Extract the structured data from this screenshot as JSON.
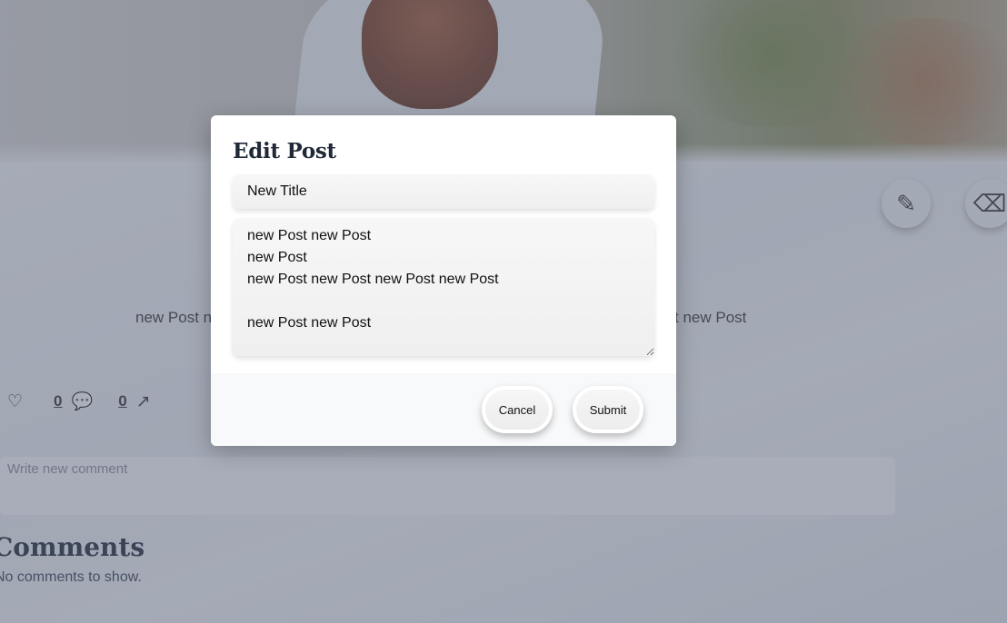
{
  "post": {
    "body_preview_left": "new Post n",
    "body_preview_right": "t new Post",
    "like_count": "0",
    "comment_count": "0"
  },
  "actions": {
    "edit_icon": "pencil-icon",
    "delete_icon": "eraser-icon"
  },
  "comment": {
    "placeholder": "Write new comment"
  },
  "comments": {
    "title": "Comments",
    "empty_text": "No comments to show."
  },
  "modal": {
    "title": "Edit Post",
    "title_value": "New Title",
    "body_value": "new Post new Post\nnew Post\nnew Post new Post new Post new Post\n\nnew Post new Post",
    "cancel_label": "Cancel",
    "submit_label": "Submit"
  }
}
